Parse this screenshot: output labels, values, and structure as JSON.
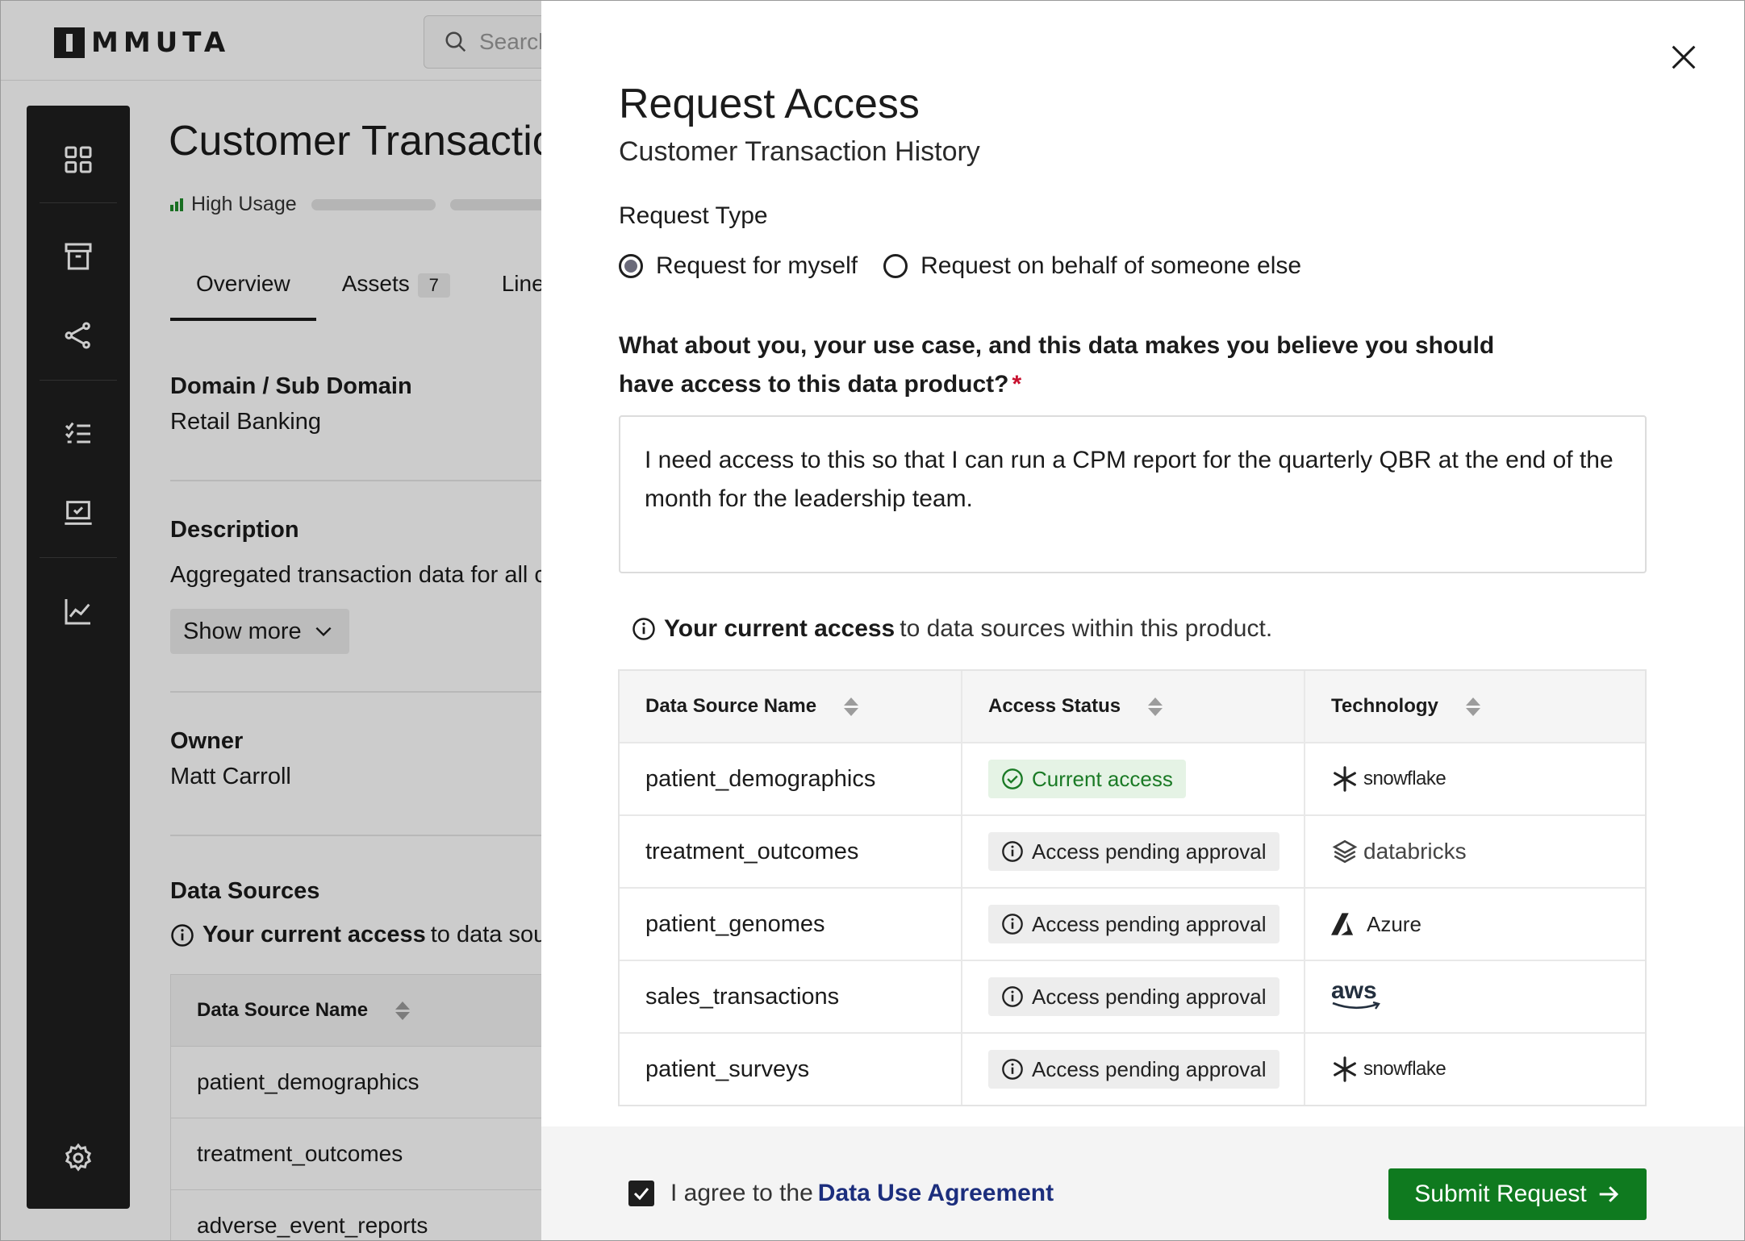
{
  "app": {
    "logo_text": "MMUTA",
    "search_placeholder": "Search"
  },
  "sidebar": {
    "items": [
      {
        "icon": "dashboard-grid-icon"
      },
      {
        "icon": "archive-box-icon"
      },
      {
        "icon": "share-nodes-icon"
      },
      {
        "icon": "checklist-icon"
      },
      {
        "icon": "laptop-check-icon"
      },
      {
        "icon": "line-chart-icon"
      }
    ],
    "settings_icon": "gear-icon"
  },
  "background_page": {
    "title": "Customer Transaction History",
    "usage_label": "High Usage",
    "tabs": [
      {
        "label": "Overview",
        "active": true
      },
      {
        "label": "Assets",
        "count": "7"
      },
      {
        "label": "Lineage"
      }
    ],
    "domain_label": "Domain / Sub Domain",
    "domain_value": "Retail Banking",
    "description_label": "Description",
    "description_value": "Aggregated transaction data for all customers",
    "show_more": "Show more",
    "owner_label": "Owner",
    "owner_value": "Matt Carroll",
    "data_sources_label": "Data Sources",
    "access_note_bold": "Your current access",
    "access_note_rest": "to data sources within this product.",
    "table_header": "Data Source Name",
    "rows": [
      "patient_demographics",
      "treatment_outcomes",
      "adverse_event_reports"
    ]
  },
  "modal": {
    "title": "Request Access",
    "subtitle": "Customer Transaction History",
    "request_type_label": "Request Type",
    "radio_options": [
      {
        "label": "Request for myself",
        "checked": true
      },
      {
        "label": "Request on behalf of someone else",
        "checked": false
      }
    ],
    "question": "What about you, your use case, and this data makes you believe you should have access to this data product?",
    "required_mark": "*",
    "answer": "I need access to this so that I can run a CPM  report for the quarterly QBR at the end of the month for the leadership team.",
    "access_note_bold": "Your current access",
    "access_note_rest": "to data sources within this product.",
    "table": {
      "headers": [
        "Data Source Name",
        "Access Status",
        "Technology"
      ],
      "rows": [
        {
          "name": "patient_demographics",
          "status": "Current access",
          "status_type": "current",
          "tech": "snowflake"
        },
        {
          "name": "treatment_outcomes",
          "status": "Access pending approval",
          "status_type": "pending",
          "tech": "databricks"
        },
        {
          "name": "patient_genomes",
          "status": "Access pending approval",
          "status_type": "pending",
          "tech": "Azure"
        },
        {
          "name": "sales_transactions",
          "status": "Access pending approval",
          "status_type": "pending",
          "tech": "aws"
        },
        {
          "name": "patient_surveys",
          "status": "Access pending approval",
          "status_type": "pending",
          "tech": "snowflake"
        }
      ]
    },
    "agree_prefix": "I agree to the",
    "agree_link": "Data Use Agreement",
    "agree_checked": true,
    "submit_label": "Submit Request"
  },
  "colors": {
    "submit_green": "#0f7a1f",
    "current_access_bg": "#e5f3e5",
    "current_access_text": "#1a7a25",
    "pending_bg": "#ededed",
    "link_blue": "#1c2e7d",
    "required_red": "#c8102e",
    "sidebar_bg": "#1f1f1f"
  }
}
